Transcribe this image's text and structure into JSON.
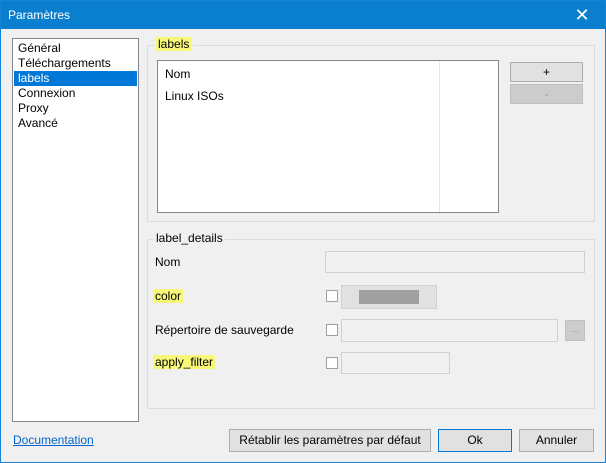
{
  "window": {
    "title": "Paramètres",
    "close_glyph": "✕"
  },
  "sidebar": {
    "items": [
      {
        "label": "Général"
      },
      {
        "label": "Téléchargements"
      },
      {
        "label": "labels",
        "selected": true
      },
      {
        "label": "Connexion"
      },
      {
        "label": "Proxy"
      },
      {
        "label": "Avancé"
      }
    ]
  },
  "labels_group": {
    "title": "labels",
    "list": {
      "rows": [
        "Nom",
        "Linux ISOs"
      ]
    },
    "add_label": "+",
    "remove_label": "-"
  },
  "details": {
    "title": "label_details",
    "name_label": "Nom",
    "color_label": "color",
    "save_dir_label": "Répertoire de sauvegarde",
    "browse_label": "...",
    "apply_filter_label": "apply_filter",
    "color_swatch": "#a0a0a0"
  },
  "footer": {
    "doc_link": "Documentation",
    "reset_label": "Rétablir les paramètres par défaut",
    "ok_label": "Ok",
    "cancel_label": "Annuler"
  },
  "highlight_color": "#f7f77a"
}
